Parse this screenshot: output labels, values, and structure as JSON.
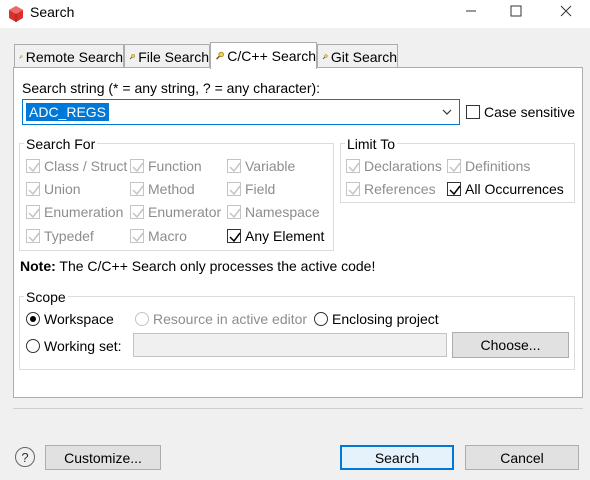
{
  "window": {
    "title": "Search"
  },
  "tabs": [
    {
      "label": "Remote Search",
      "active": false
    },
    {
      "label": "File Search",
      "active": false
    },
    {
      "label": "C/C++ Search",
      "active": true
    },
    {
      "label": "Git Search",
      "active": false
    }
  ],
  "search": {
    "label": "Search string (* = any string, ? = any character):",
    "value": "ADC_REGS",
    "case_sensitive": {
      "label": "Case sensitive",
      "checked": false
    }
  },
  "search_for": {
    "title": "Search For",
    "items": [
      {
        "label": "Class / Struct",
        "checked": true,
        "enabled": false
      },
      {
        "label": "Function",
        "checked": true,
        "enabled": false
      },
      {
        "label": "Variable",
        "checked": true,
        "enabled": false
      },
      {
        "label": "Union",
        "checked": true,
        "enabled": false
      },
      {
        "label": "Method",
        "checked": true,
        "enabled": false
      },
      {
        "label": "Field",
        "checked": true,
        "enabled": false
      },
      {
        "label": "Enumeration",
        "checked": true,
        "enabled": false
      },
      {
        "label": "Enumerator",
        "checked": true,
        "enabled": false
      },
      {
        "label": "Namespace",
        "checked": true,
        "enabled": false
      },
      {
        "label": "Typedef",
        "checked": true,
        "enabled": false
      },
      {
        "label": "Macro",
        "checked": true,
        "enabled": false
      },
      {
        "label": "Any Element",
        "checked": true,
        "enabled": true
      }
    ]
  },
  "limit_to": {
    "title": "Limit To",
    "items": [
      {
        "label": "Declarations",
        "checked": true,
        "enabled": false
      },
      {
        "label": "Definitions",
        "checked": true,
        "enabled": false
      },
      {
        "label": "References",
        "checked": true,
        "enabled": false
      },
      {
        "label": "All Occurrences",
        "checked": true,
        "enabled": true
      }
    ]
  },
  "note": {
    "bold": "Note:",
    "text": " The C/C++ Search only processes the active code!"
  },
  "scope": {
    "title": "Scope",
    "workspace": "Workspace",
    "active_editor": "Resource in active editor",
    "enclosing_project": "Enclosing project",
    "working_set": "Working set:",
    "working_set_value": "",
    "choose_label": "Choose...",
    "selected": "Workspace"
  },
  "footer": {
    "help": "?",
    "customize": "Customize...",
    "search": "Search",
    "cancel": "Cancel"
  },
  "colors": {
    "accent": "#0078d7",
    "icon_red": "#d9302e"
  }
}
